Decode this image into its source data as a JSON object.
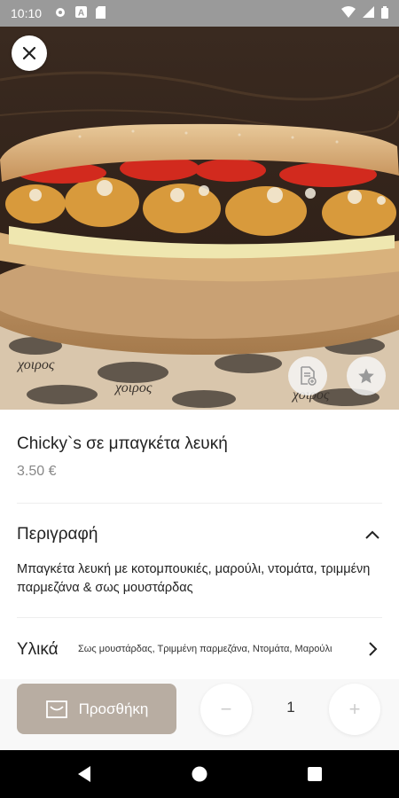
{
  "status_bar": {
    "time": "10:10",
    "icons": [
      "gear-icon",
      "a-icon",
      "sd-card-icon"
    ],
    "right_icons": [
      "wifi-icon",
      "signal-icon",
      "battery-icon"
    ]
  },
  "product": {
    "title": "Chicky`s σε μπαγκέτα λευκή",
    "price": "3.50 €",
    "logo_text": "χοιρος"
  },
  "description": {
    "header": "Περιγραφή",
    "text": "Μπαγκέτα λευκή με κοτομπουκιές, μαρούλι, ντομάτα, τριμμένη παρμεζάνα & σως μουστάρδας"
  },
  "ingredients": {
    "label": "Υλικά",
    "list": "Σως μουστάρδας, Τριμμένη παρμεζάνα, Ντομάτα, Μαρούλι"
  },
  "cart": {
    "add_label": "Προσθήκη",
    "quantity": "1",
    "minus": "−",
    "plus": "+"
  },
  "colors": {
    "add_button": "#b8ada2",
    "status_bar": "#9a9a9a"
  }
}
